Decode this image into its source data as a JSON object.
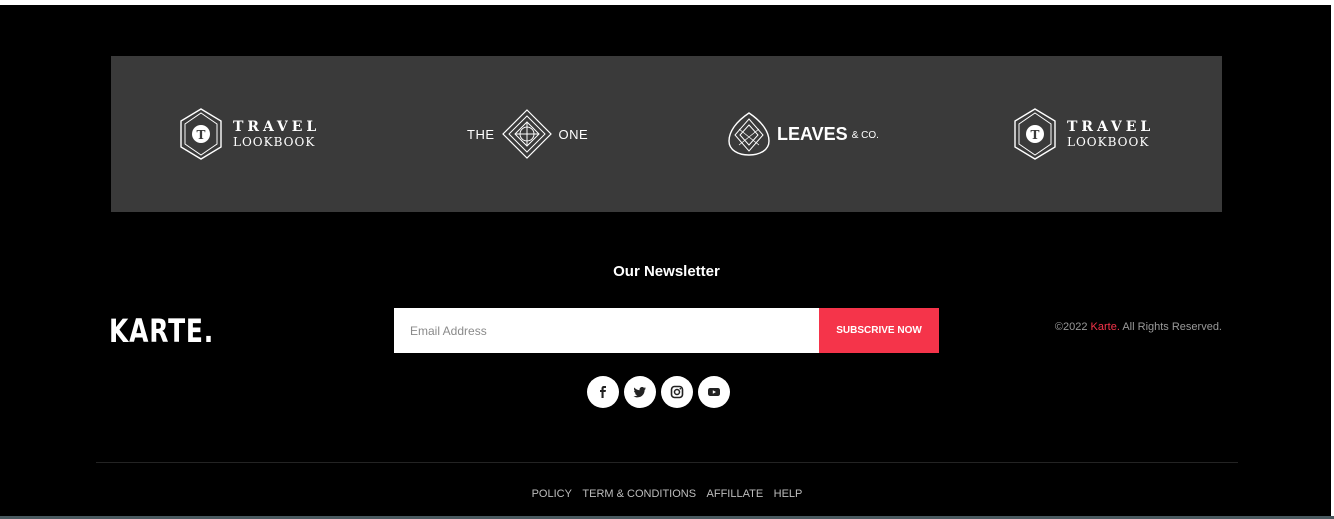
{
  "brands": [
    {
      "line1": "TRAVEL",
      "line2": "LOOKBOOK",
      "icon": "travel-lookbook-badge-icon"
    },
    {
      "left": "THE",
      "right": "ONE",
      "icon": "geometric-diamond-icon"
    },
    {
      "word": "LEAVES",
      "suffix": "& CO.",
      "icon": "leaf-lines-icon"
    },
    {
      "line1": "TRAVEL",
      "line2": "LOOKBOOK",
      "icon": "travel-lookbook-badge-icon"
    }
  ],
  "newsletter": {
    "title": "Our Newsletter",
    "email_placeholder": "Email Address",
    "button_label": "SUBSCRIVE NOW"
  },
  "logo": "KARTE.",
  "copyright": {
    "prefix": "©2022 ",
    "brand": "Karte.",
    "suffix": " All Rights Reserved."
  },
  "socials": [
    {
      "icon": "facebook-icon"
    },
    {
      "icon": "twitter-icon"
    },
    {
      "icon": "instagram-icon"
    },
    {
      "icon": "youtube-icon"
    }
  ],
  "footer_links": [
    "POLICY",
    "TERM & CONDITIONS",
    "AFFILLATE",
    "HELP"
  ],
  "colors": {
    "accent": "#f5344a",
    "background": "#000000",
    "brands_panel": "#3a3a3a"
  }
}
